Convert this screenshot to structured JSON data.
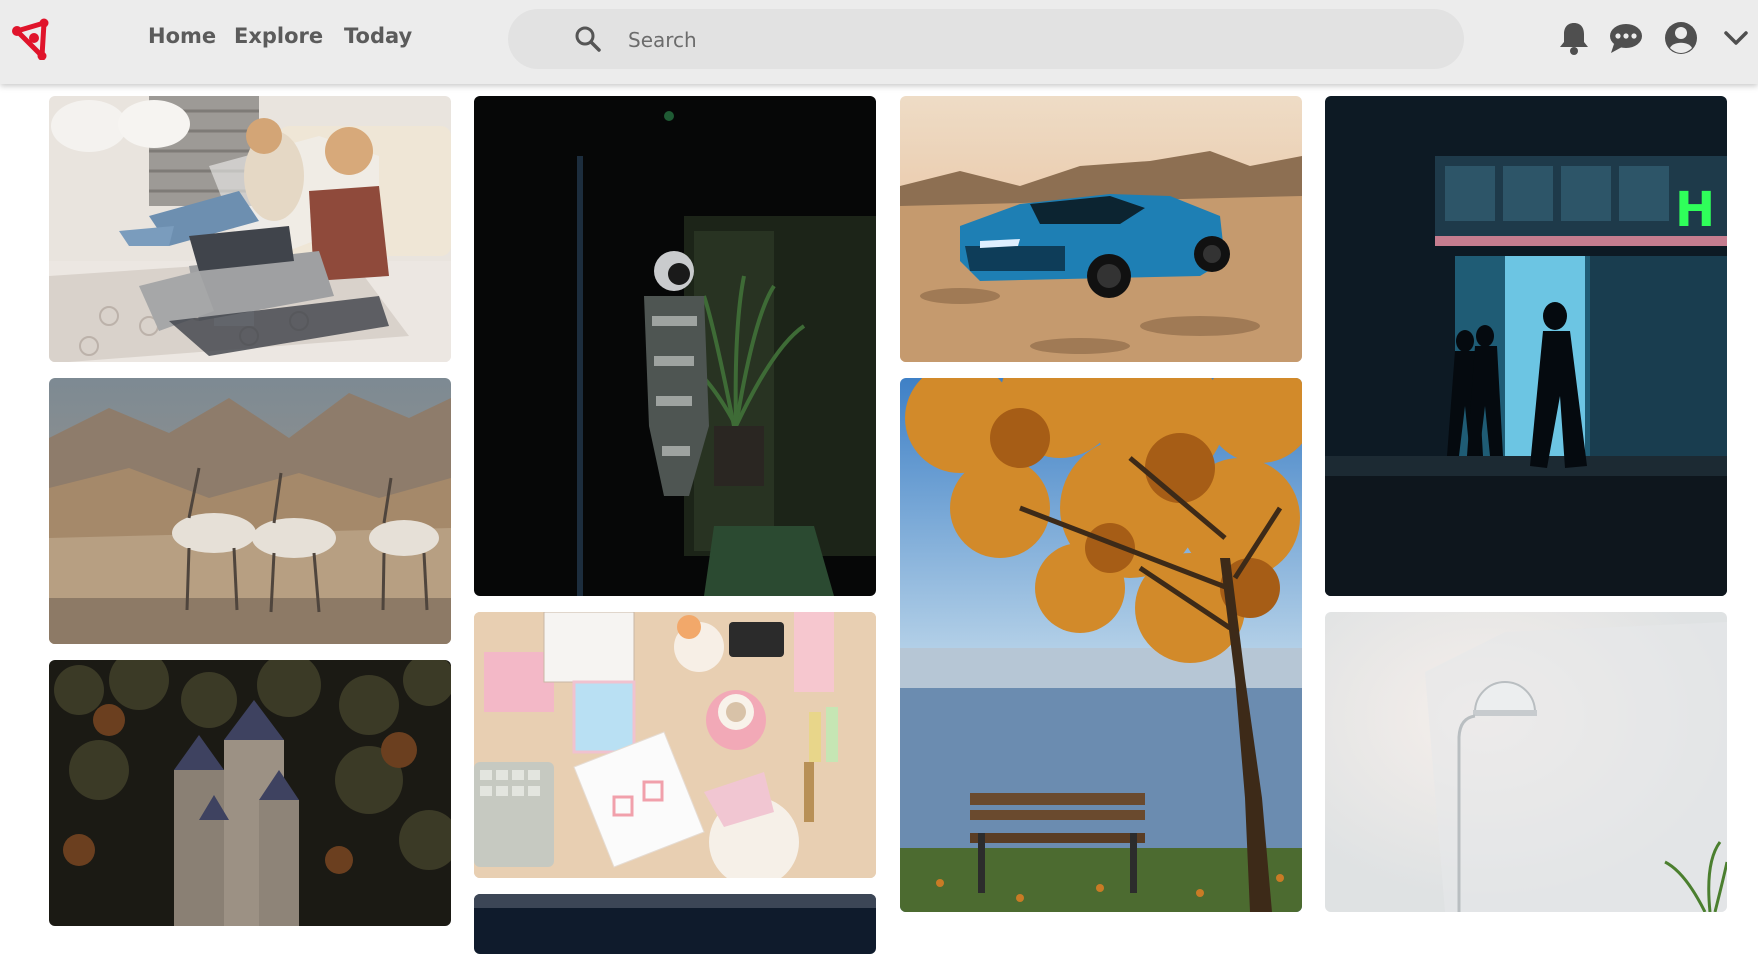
{
  "brand": {
    "logo_icon": "pinboard-logo-icon",
    "accent": "#e0142b"
  },
  "nav": {
    "home": "Home",
    "explore": "Explore",
    "today": "Today"
  },
  "search": {
    "placeholder": "Search",
    "value": ""
  },
  "header_icons": [
    "bell-icon",
    "chat-icon",
    "account-icon",
    "chevron-down-icon"
  ],
  "feed": {
    "pins": [
      {
        "subject": "kids-on-couch"
      },
      {
        "subject": "astronaut-dark-room"
      },
      {
        "subject": "blue-sports-car"
      },
      {
        "subject": "neon-storefront-night"
      },
      {
        "subject": "antelopes-desert"
      },
      {
        "subject": "pink-desk-flatlay"
      },
      {
        "subject": "autumn-tree-lake-bench"
      },
      {
        "subject": "white-floor-lamp"
      },
      {
        "subject": "castle-forest"
      },
      {
        "subject": "night-sky"
      }
    ],
    "storefront_sign_text": "H"
  }
}
